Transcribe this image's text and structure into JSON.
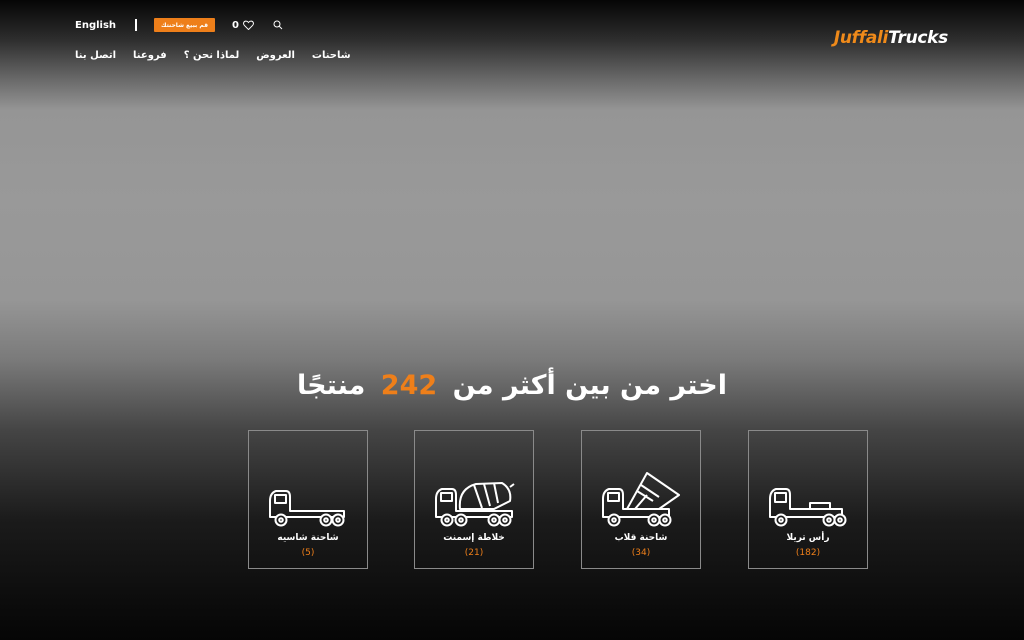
{
  "header": {
    "logo_part1": "Juffali",
    "logo_part2": "Trucks",
    "language": "English",
    "cta": "قم ببيع شاحنتك",
    "favorites_count": "0"
  },
  "nav": {
    "items": [
      "اتصل بنا",
      "فروعنا",
      "لماذا نحن ؟",
      "العروض",
      "شاحنات"
    ]
  },
  "headline": {
    "prefix": "اختر من بين أكثر من",
    "number": "242",
    "suffix": "منتجًا"
  },
  "categories": [
    {
      "label": "رأس تريلا",
      "count": "(182)",
      "icon": "tractor-head-icon"
    },
    {
      "label": "شاحنة قلاب",
      "count": "(34)",
      "icon": "dump-truck-icon"
    },
    {
      "label": "خلاطة إسمنت",
      "count": "(21)",
      "icon": "cement-mixer-icon"
    },
    {
      "label": "شاحنة شاسيه",
      "count": "(5)",
      "icon": "chassis-truck-icon"
    }
  ],
  "colors": {
    "accent": "#ee7f1a",
    "text": "#ffffff"
  }
}
